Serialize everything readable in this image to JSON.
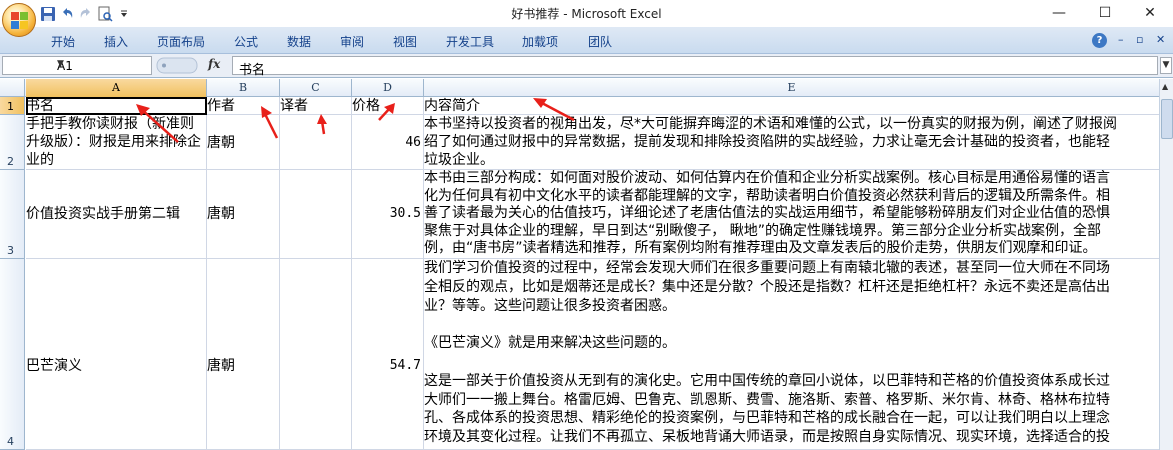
{
  "window": {
    "title": "好书推荐 - Microsoft Excel",
    "minimize": "—",
    "restore": "☐",
    "close": "✕"
  },
  "ribbon": {
    "tabs": [
      "开始",
      "插入",
      "页面布局",
      "公式",
      "数据",
      "审阅",
      "视图",
      "开发工具",
      "加载项",
      "团队"
    ],
    "help": "?",
    "min": "–",
    "restore": "▫",
    "close": "✕"
  },
  "formula_bar": {
    "cell_ref": "A1",
    "fx": "fx",
    "content": "书名"
  },
  "sheet": {
    "columns": [
      "A",
      "B",
      "C",
      "D",
      "E"
    ],
    "rows": [
      "1",
      "2",
      "3",
      "4"
    ],
    "header": {
      "a": "书名",
      "b": "作者",
      "c": "译者",
      "d": "价格",
      "e": "内容简介"
    },
    "r2": {
      "a": "手把手教你读财报（新准则升级版）：财报是用来排除企业的",
      "b": "唐朝",
      "c": "",
      "d": "46",
      "e": [
        "本书坚持以投资者的视角出发，尽*大可能摒弃晦涩的术语和难懂的公式，以一份真实的财报为例，阐述了财报阅",
        "绍了如何通过财报中的异常数据，提前发现和排除投资陷阱的实战经验，力求让毫无会计基础的投资者，也能轻",
        "垃圾企业。"
      ]
    },
    "r3": {
      "a": "价值投资实战手册第二辑",
      "b": "唐朝",
      "c": "",
      "d": "30.5",
      "e": [
        "本书由三部分构成：如何面对股价波动、如何估算内在价值和企业分析实战案例。核心目标是用通俗易懂的语言",
        "化为任何具有初中文化水平的读者都能理解的文字，帮助读者明白价值投资必然获利背后的逻辑及所需条件。相",
        "善了读者最为关心的估值技巧，详细论述了老唐估值法的实战运用细节，希望能够粉碎朋友们对企业估值的恐惧",
        "聚焦于对具体企业的理解，早日到达“别瞅傻子，  瞅地”的确定性赚钱境界。第三部分企业分析实战案例，全部",
        "例，由“唐书房”读者精选和推荐，所有案例均附有推荐理由及文章发表后的股价走势，供朋友们观摩和印证。"
      ]
    },
    "r4": {
      "a": "巴芒演义",
      "b": "唐朝",
      "c": "",
      "d": "54.7",
      "e": [
        "我们学习价值投资的过程中，经常会发现大师们在很多重要问题上有南辕北辙的表述，甚至同一位大师在不同场",
        "全相反的观点，比如是烟蒂还是成长？集中还是分散？个股还是指数？杠杆还是拒绝杠杆？永远不卖还是高估出",
        "业？等等。这些问题让很多投资者困惑。",
        "",
        "《巴芒演义》就是用来解决这些问题的。",
        "",
        "这是一部关于价值投资从无到有的演化史。它用中国传统的章回小说体，以巴菲特和芒格的价值投资体系成长过",
        "大师们一一搬上舞台。格雷厄姆、巴鲁克、凯恩斯、费雪、施洛斯、索普、格罗斯、米尔肯、林奇、格林布拉特",
        "孔、各成体系的投资思想、精彩绝伦的投资案例，与巴菲特和芒格的成长融合在一起，可以让我们明白以上理念",
        "环境及其变化过程。让我们不再孤立、呆板地背诵大师语录，而是按照自身实际情况、现实环境，选择适合的投"
      ]
    }
  },
  "colors": {
    "annotation_arrow": "#e8201a",
    "ribbon_text": "#15428b",
    "selected_header": "#f1c15f"
  }
}
